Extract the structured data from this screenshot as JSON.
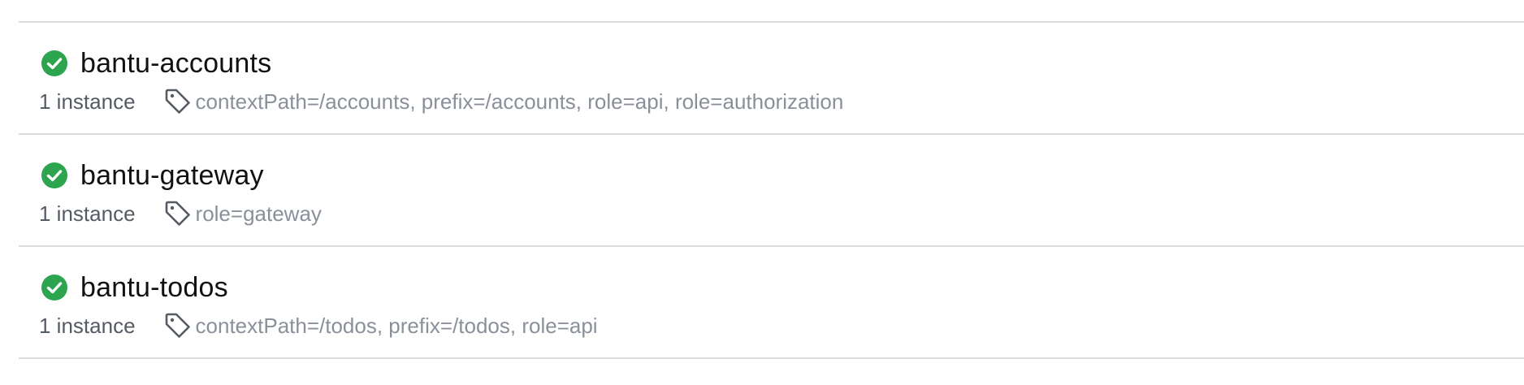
{
  "colors": {
    "status_ok": "#2da44e",
    "divider": "#dcdcdc",
    "name_text": "#111111",
    "meta_text": "#555b63",
    "tags_text": "#8a9099"
  },
  "services": [
    {
      "name": "bantu-accounts",
      "status_icon": "check-circle-icon",
      "instances": "1 instance",
      "tag_icon": "tag-icon",
      "tags": "contextPath=/accounts, prefix=/accounts, role=api, role=authorization"
    },
    {
      "name": "bantu-gateway",
      "status_icon": "check-circle-icon",
      "instances": "1 instance",
      "tag_icon": "tag-icon",
      "tags": "role=gateway"
    },
    {
      "name": "bantu-todos",
      "status_icon": "check-circle-icon",
      "instances": "1 instance",
      "tag_icon": "tag-icon",
      "tags": "contextPath=/todos, prefix=/todos, role=api"
    }
  ]
}
